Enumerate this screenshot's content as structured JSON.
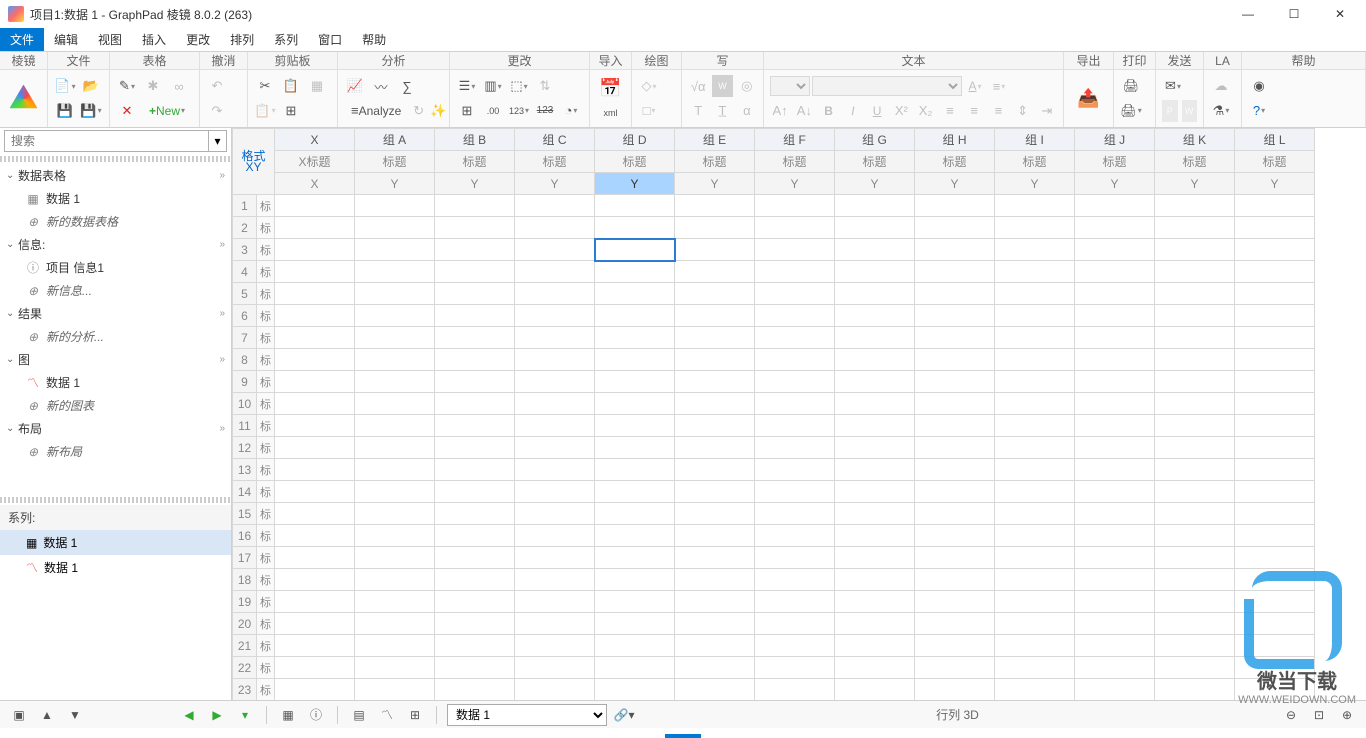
{
  "title": "项目1:数据 1 - GraphPad 棱镜 8.0.2 (263)",
  "menu": [
    "文件",
    "编辑",
    "视图",
    "插入",
    "更改",
    "排列",
    "系列",
    "窗口",
    "帮助"
  ],
  "ribbon_labels": {
    "l0": "棱镜",
    "l1": "文件",
    "l2": "表格",
    "l3": "撤消",
    "l4": "剪贴板",
    "l5": "分析",
    "l6": "更改",
    "l7": "导入",
    "l8": "绘图",
    "l9": "写",
    "l10": "文本",
    "l11": "导出",
    "l12": "打印",
    "l13": "发送",
    "l14": "LA",
    "l15": "帮助"
  },
  "new_label": "New",
  "analyze_label": "Analyze",
  "search_placeholder": "搜索",
  "sidebar": {
    "s1": "数据表格",
    "s1a": "数据 1",
    "s1b": "新的数据表格",
    "s2": "信息:",
    "s2a": "项目 信息1",
    "s2b": "新信息...",
    "s3": "结果",
    "s3a": "新的分析...",
    "s4": "图",
    "s4a": "数据 1",
    "s4b": "新的图表",
    "s5": "布局",
    "s5a": "新布局"
  },
  "series_header": "系列:",
  "series_items": [
    "数据 1",
    "数据 1"
  ],
  "fmt_label": "格式",
  "fmt_sub": "XY",
  "x_col": "X",
  "x_title": "X标题",
  "groups": [
    "组 A",
    "组 B",
    "组 C",
    "组 D",
    "组 E",
    "组 F",
    "组 G",
    "组 H",
    "组 I",
    "组 J",
    "组 K",
    "组 L"
  ],
  "col_title": "标题",
  "y_label": "Y",
  "row_lbl": "标",
  "status": {
    "sel": "数据 1",
    "center": "行列 3D"
  },
  "watermark": {
    "t1": "微当下载",
    "t2": "WWW.WEIDOWN.COM"
  }
}
